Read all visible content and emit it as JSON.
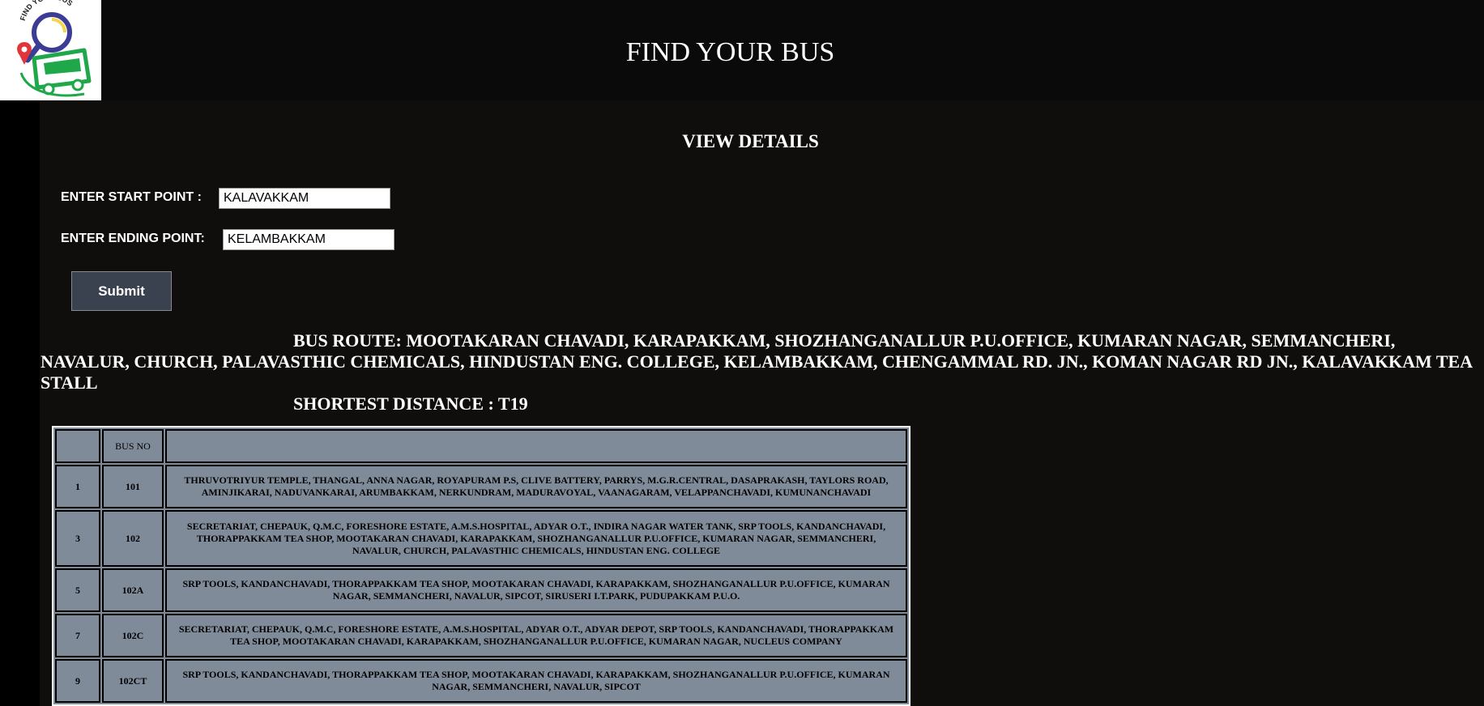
{
  "header": {
    "logo_text": "FIND YOUR BUS",
    "title": "FIND YOUR BUS"
  },
  "main": {
    "section_title": "VIEW DETAILS",
    "form": {
      "start_label": "ENTER START POINT :",
      "start_value": "KALAVAKKAM",
      "end_label": "ENTER ENDING POINT:",
      "end_value": "KELAMBAKKAM",
      "submit_label": "Submit"
    },
    "route_text": "BUS ROUTE: MOOTAKARAN CHAVADI, KARAPAKKAM, SHOZHANGANALLUR P.U.OFFICE, KUMARAN NAGAR, SEMMANCHERI, NAVALUR, CHURCH, PALAVASTHIC CHEMICALS, HINDUSTAN ENG. COLLEGE, KELAMBAKKAM, CHENGAMMAL RD. JN., KOMAN NAGAR RD JN., KALAVAKKAM TEA STALL",
    "shortest_text": "SHORTEST DISTANCE : T19"
  },
  "table": {
    "headers": [
      "",
      "BUS NO",
      ""
    ],
    "rows": [
      {
        "sno": "1",
        "bus_no": "101",
        "stops": "THRUVOTRIYUR TEMPLE, THANGAL, ANNA NAGAR, ROYAPURAM P.S, CLIVE BATTERY, PARRYS, M.G.R.CENTRAL, DASAPRAKASH, TAYLORS ROAD, AMINJIKARAI, NADUVANKARAI, ARUMBAKKAM, NERKUNDRAM, MADURAVOYAL, VAANAGARAM, VELAPPANCHAVADI, KUMUNANCHAVADI"
      },
      {
        "sno": "3",
        "bus_no": "102",
        "stops": "SECRETARIAT, CHEPAUK, Q.M.C, FORESHORE ESTATE, A.M.S.HOSPITAL, ADYAR O.T., INDIRA NAGAR WATER TANK, SRP TOOLS, KANDANCHAVADI, THORAPPAKKAM TEA SHOP, MOOTAKARAN CHAVADI, KARAPAKKAM, SHOZHANGANALLUR P.U.OFFICE, KUMARAN NAGAR, SEMMANCHERI, NAVALUR, CHURCH, PALAVASTHIC CHEMICALS, HINDUSTAN ENG. COLLEGE"
      },
      {
        "sno": "5",
        "bus_no": "102A",
        "stops": "SRP TOOLS, KANDANCHAVADI, THORAPPAKKAM TEA SHOP, MOOTAKARAN CHAVADI, KARAPAKKAM, SHOZHANGANALLUR P.U.OFFICE, KUMARAN NAGAR, SEMMANCHERI, NAVALUR, SIPCOT, SIRUSERI I.T.PARK, PUDUPAKKAM P.U.O."
      },
      {
        "sno": "7",
        "bus_no": "102C",
        "stops": "SECRETARIAT, CHEPAUK, Q.M.C, FORESHORE ESTATE, A.M.S.HOSPITAL, ADYAR O.T., ADYAR DEPOT, SRP TOOLS, KANDANCHAVADI, THORAPPAKKAM TEA SHOP, MOOTAKARAN CHAVADI, KARAPAKKAM, SHOZHANGANALLUR P.U.OFFICE, KUMARAN NAGAR, NUCLEUS COMPANY"
      },
      {
        "sno": "9",
        "bus_no": "102CT",
        "stops": "SRP TOOLS, KANDANCHAVADI, THORAPPAKKAM TEA SHOP, MOOTAKARAN CHAVADI, KARAPAKKAM, SHOZHANGANALLUR P.U.OFFICE, KUMARAN NAGAR, SEMMANCHERI, NAVALUR, SIPCOT"
      }
    ]
  },
  "colors": {
    "header_bg": "#0a0a0a",
    "page_bg": "#0f0e0d",
    "table_bg": "#808b9a",
    "button_bg": "#3a4250",
    "logo_ring": "#3d3c94",
    "logo_bus": "#1ea84a",
    "logo_pin": "#e0353b"
  }
}
